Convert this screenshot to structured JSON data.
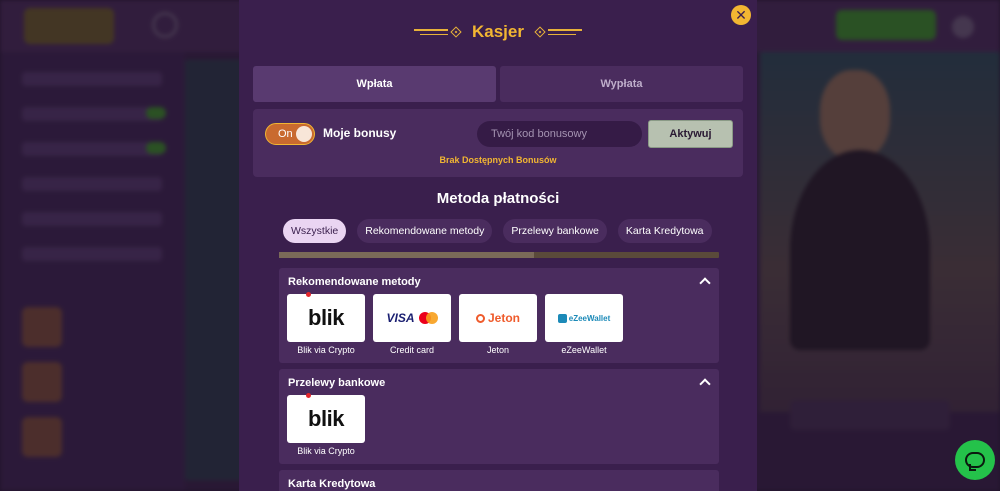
{
  "modal": {
    "title": "Kasjer",
    "close_icon": "close-icon",
    "accent_color": "#f2b632",
    "tabs": [
      {
        "label": "Wpłata",
        "active": true
      },
      {
        "label": "Wypłata",
        "active": false
      }
    ],
    "bonus": {
      "toggle_state": "On",
      "label": "Moje bonusy",
      "input_placeholder": "Twój kod bonusowy",
      "activate_label": "Aktywuj",
      "no_bonus_text": "Brak Dostępnych Bonusów"
    },
    "payment": {
      "title": "Metoda płatności",
      "chips": [
        {
          "label": "Wszystkie",
          "active": true
        },
        {
          "label": "Rekomendowane metody",
          "active": false
        },
        {
          "label": "Przelewy bankowe",
          "active": false
        },
        {
          "label": "Karta Kredytowa",
          "active": false
        }
      ],
      "groups": [
        {
          "title": "Rekomendowane metody",
          "methods": [
            {
              "logo": "blik",
              "label": "Blik via Crypto"
            },
            {
              "logo": "VISA",
              "label": "Credit card"
            },
            {
              "logo": "Jeton",
              "label": "Jeton"
            },
            {
              "logo": "eZeeWallet",
              "label": "eZeeWallet"
            }
          ]
        },
        {
          "title": "Przelewy bankowe",
          "methods": [
            {
              "logo": "blik",
              "label": "Blik via Crypto"
            }
          ]
        },
        {
          "title": "Karta Kredytowa",
          "methods": []
        }
      ]
    }
  },
  "chat": {
    "icon": "chat-bubble-icon",
    "color": "#24c24a"
  }
}
